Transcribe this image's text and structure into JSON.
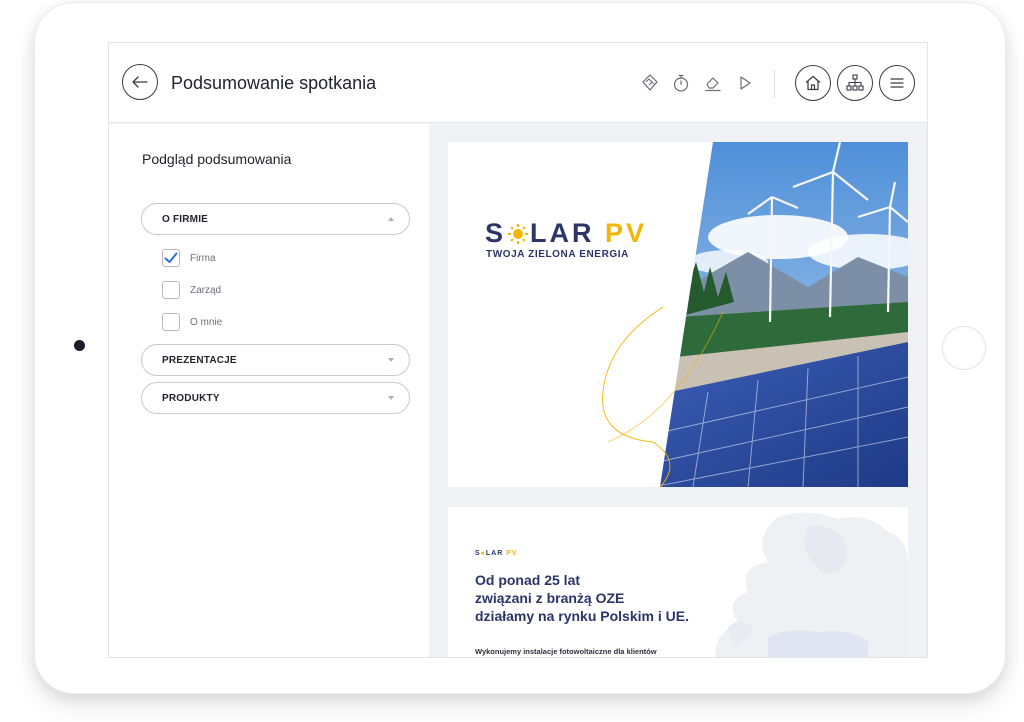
{
  "topbar": {
    "title": "Podsumowanie spotkania"
  },
  "icons": {
    "back": "arrow-left-icon",
    "tools": [
      "handshake-icon",
      "timer-icon",
      "eraser-icon",
      "play-icon"
    ],
    "nav": [
      "home-icon",
      "sitemap-icon",
      "menu-icon"
    ]
  },
  "sidebar": {
    "title": "Podgląd podsumowania",
    "sections": [
      {
        "label": "O FIRMIE",
        "expanded": true,
        "items": [
          {
            "label": "Firma",
            "checked": true
          },
          {
            "label": "Zarząd",
            "checked": false
          },
          {
            "label": "O mnie",
            "checked": false
          }
        ]
      },
      {
        "label": "PREZENTACJE",
        "expanded": false
      },
      {
        "label": "PRODUKTY",
        "expanded": false
      }
    ]
  },
  "slides": {
    "cover": {
      "logo_main": "S",
      "logo_rest": "LAR",
      "logo_pv": "PV",
      "tagline": "TWOJA ZIELONA ENERGIA"
    },
    "about": {
      "logo_main": "S",
      "logo_rest": "LAR",
      "logo_pv": "PV",
      "heading_lines": [
        "Od ponad 25 lat",
        "związani z branżą OZE",
        "działamy na rynku Polskim i UE."
      ],
      "body": "Wykonujemy instalacje fotowoltaiczne dla klientów"
    }
  },
  "colors": {
    "brand_navy": "#2b3567",
    "brand_yellow": "#f2b705",
    "check_blue": "#2b6fd6"
  }
}
